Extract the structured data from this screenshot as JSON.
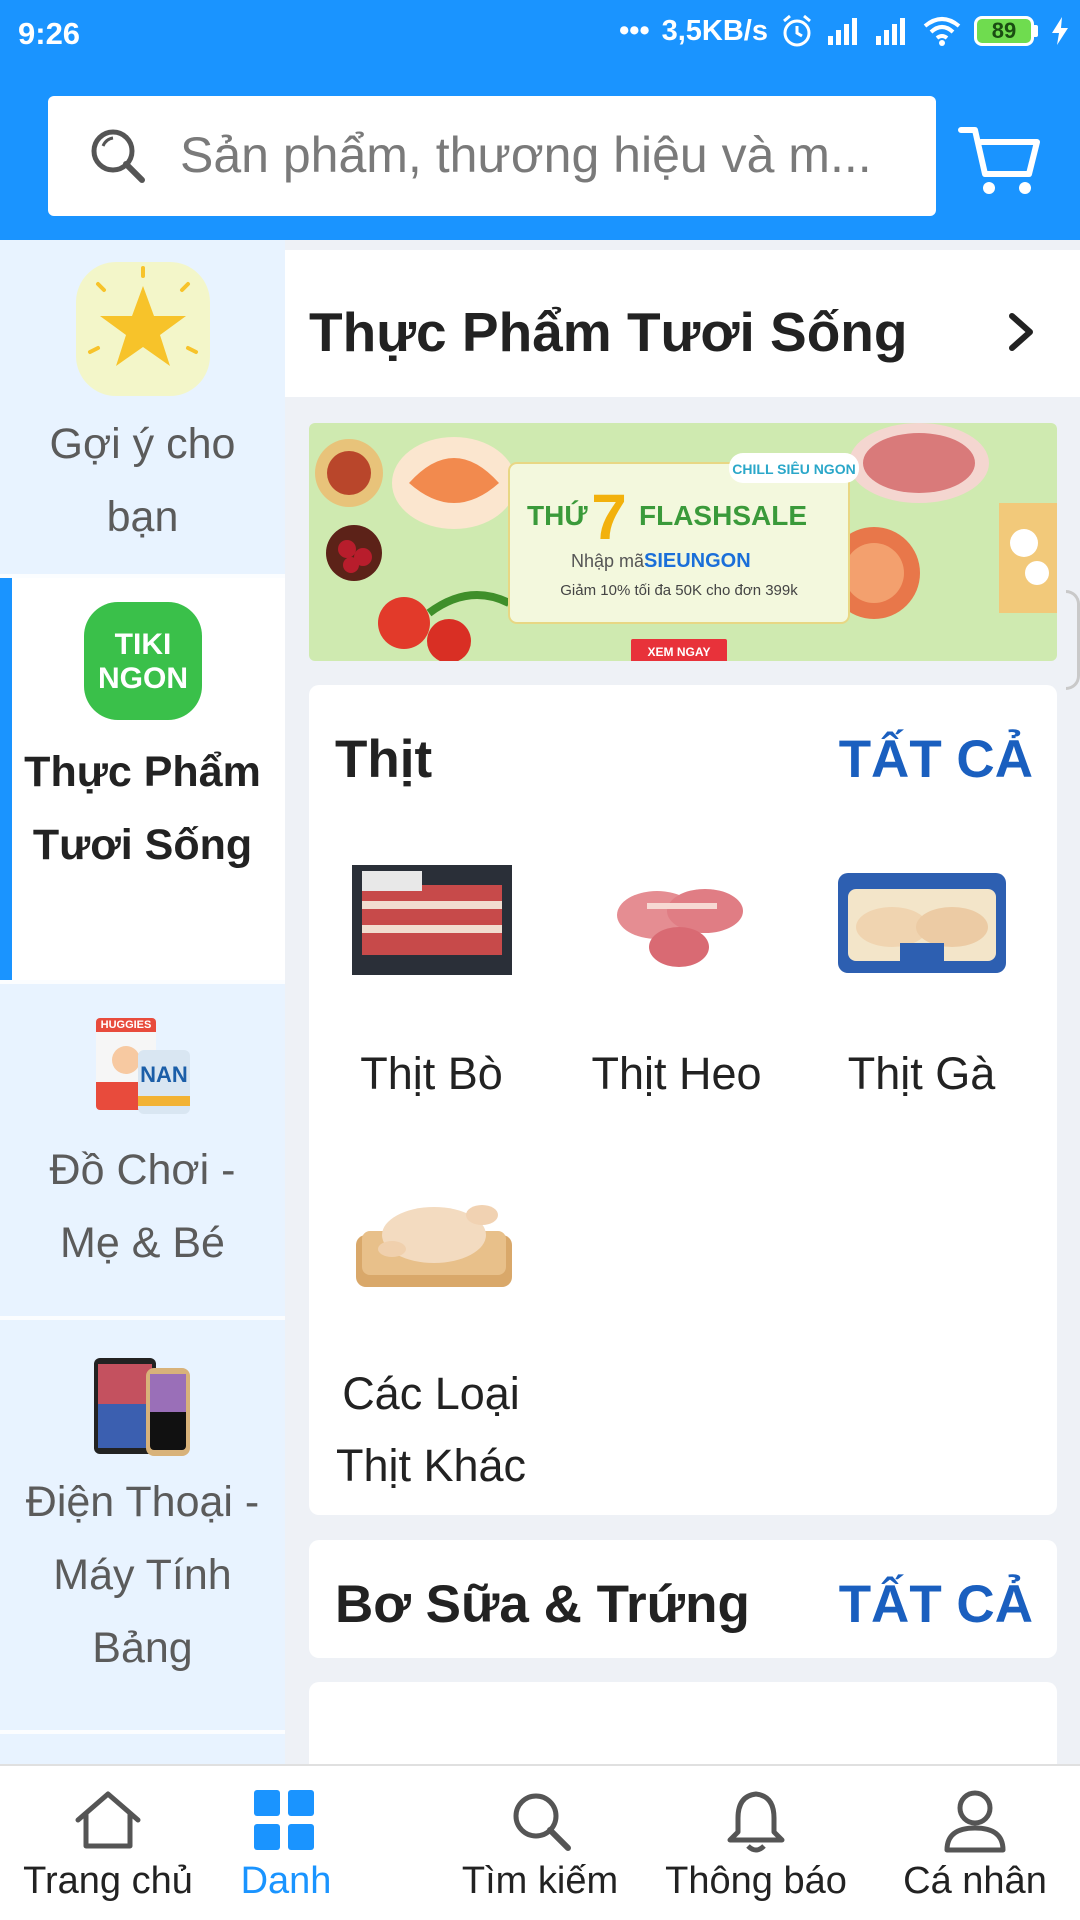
{
  "status": {
    "time": "9:26",
    "network_speed": "3,5KB/s",
    "battery": "89",
    "signal_dots": "•••"
  },
  "search": {
    "placeholder": "Sản phẩm, thương hiệu và m..."
  },
  "sidebar": {
    "items": [
      {
        "label": "Gợi ý cho bạn",
        "icon": "star-icon",
        "active": false
      },
      {
        "label": "Thực Phẩm Tươi Sống",
        "icon": "tiki-ngon-logo",
        "active": true
      },
      {
        "label": "Đồ Chơi - Mẹ & Bé",
        "icon": "baby-products-icon",
        "active": false
      },
      {
        "label": "Điện Thoại - Máy Tính Bảng",
        "icon": "phones-tablet-icon",
        "active": false
      }
    ],
    "logo_text": [
      "TIKI",
      "NGON"
    ]
  },
  "category": {
    "title": "Thực Phẩm Tươi Sống"
  },
  "banner": {
    "tag": "CHILL SIÊU NGON",
    "title_left": "THỨ",
    "title_number": "7",
    "title_right": "FLASHSALE",
    "code_line_prefix": "Nhập mã",
    "code": "SIEUNGON",
    "discount_line": "Giảm 10% tối đa 50K cho đơn 399k",
    "cta": "XEM NGAY"
  },
  "sections": [
    {
      "title": "Thịt",
      "see_all": "TẤT CẢ",
      "products": [
        {
          "name": "Thịt Bò",
          "image": "beef-pack-image"
        },
        {
          "name": "Thịt Heo",
          "image": "pork-ribs-image"
        },
        {
          "name": "Thịt Gà",
          "image": "chicken-pack-image"
        },
        {
          "name": "Các Loại Thịt Khác",
          "image": "whole-chicken-image"
        }
      ]
    },
    {
      "title": "Bơ Sữa & Trứng",
      "see_all": "TẤT CẢ"
    }
  ],
  "bottom_nav": [
    {
      "label": "Trang chủ",
      "icon": "home-icon",
      "active": false
    },
    {
      "label": "Danh",
      "icon": "grid-icon",
      "active": true
    },
    {
      "label": "Tìm kiếm",
      "icon": "search-icon",
      "active": false
    },
    {
      "label": "Thông báo",
      "icon": "bell-icon",
      "active": false
    },
    {
      "label": "Cá nhân",
      "icon": "user-icon",
      "active": false
    }
  ],
  "colors": {
    "brand": "#1a94ff",
    "sidebar_bg": "#e8f3ff",
    "see_all": "#1a5fbf",
    "tiki_ngon_green": "#3ac04a"
  }
}
